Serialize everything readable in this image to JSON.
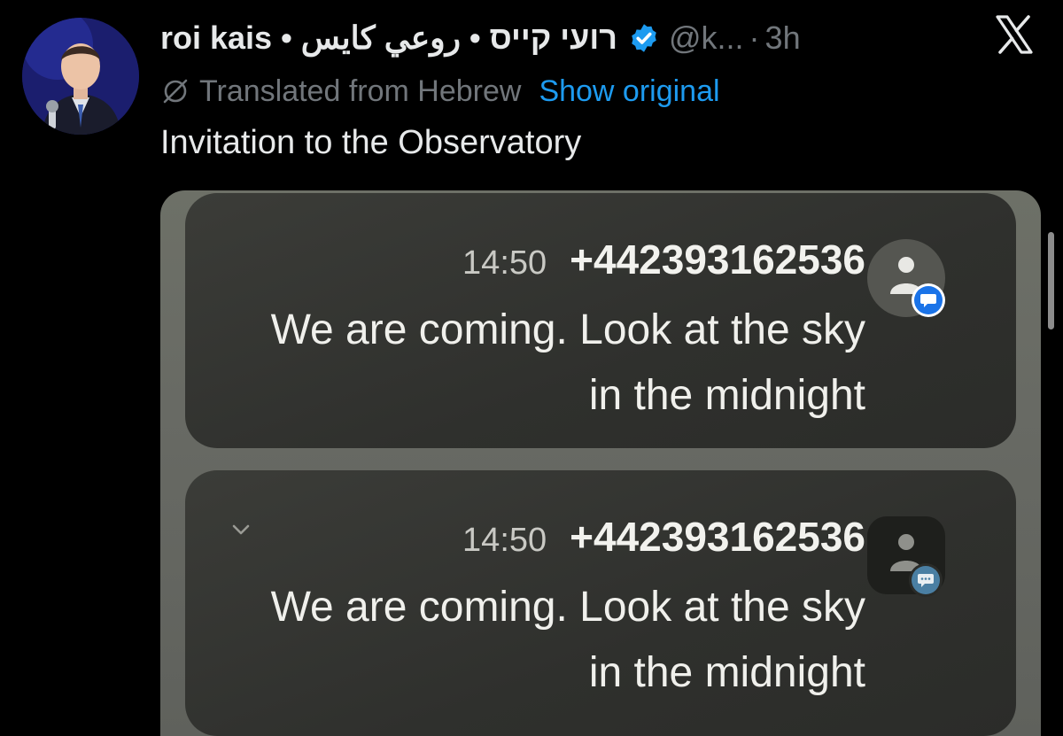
{
  "post": {
    "author_display_name": "roi kais • רועי קייס • روعي كايس",
    "handle": "@k...",
    "separator": "·",
    "timestamp": "3h",
    "translated_label": "Translated from Hebrew",
    "show_original_label": "Show original",
    "text": "Invitation to the Observatory"
  },
  "icons": {
    "avatar": "profile-photo",
    "verified": "verified-badge-icon",
    "translation": "globe-slash-icon",
    "brand": "x-logo-icon",
    "contact": "contact-person-icon",
    "chevron": "chevron-down-icon"
  },
  "colors": {
    "background": "#000000",
    "primary_text": "#e7e9ea",
    "secondary_text": "#71767b",
    "link": "#1d9bf0",
    "verified_badge": "#1d9bf0",
    "messages_badge_active": "#1a73e8",
    "messages_badge_muted": "#4a7fa3"
  },
  "media": {
    "notifications": [
      {
        "time": "14:50",
        "sender": "+442393162536",
        "body": "We are coming. Look at the sky in the midnight",
        "expandable": false
      },
      {
        "time": "14:50",
        "sender": "+442393162536",
        "body": "We are coming. Look at the sky in the midnight",
        "expandable": true
      }
    ]
  }
}
